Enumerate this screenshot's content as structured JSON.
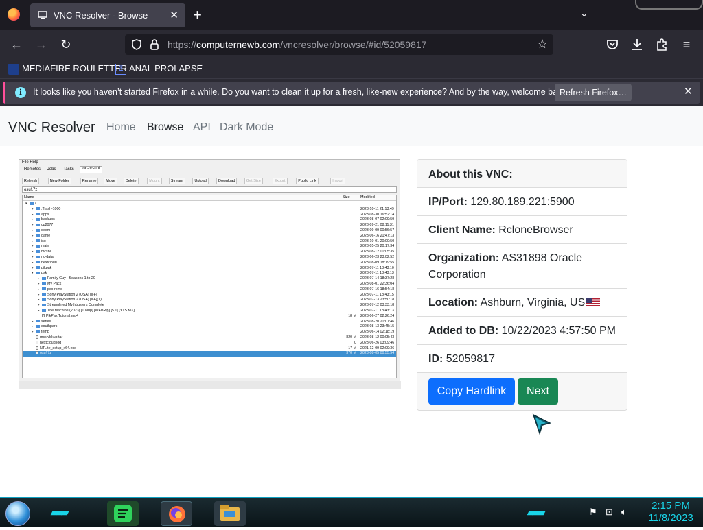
{
  "browser": {
    "tab_title": "VNC Resolver - Browse",
    "tab_close": "✕",
    "new_tab": "+",
    "url_prefix": "https://",
    "url_domain": "computernewb.com",
    "url_path": "/vncresolver/browse/#id/52059817",
    "bookmarks": [
      "MEDIAFIRE ROULETTER",
      "ANAL PROLAPSE"
    ],
    "notification": {
      "message": "It looks like you haven’t started Firefox in a while. Do you want to clean it up for a fresh, like-new experience? And by the way, welcome back!",
      "button": "Refresh Firefox…"
    }
  },
  "site": {
    "brand": "VNC Resolver",
    "nav": [
      "Home",
      "Browse",
      "API",
      "Dark Mode"
    ],
    "active_nav": "Browse"
  },
  "screenshot": {
    "menu": "File  Help",
    "tabs": [
      "Remotes",
      "Jobs",
      "Tasks",
      "od-nc-uni"
    ],
    "toolbar": [
      "Refresh",
      "New Folder",
      "Rename",
      "Move",
      "Delete",
      "Mount",
      "Stream",
      "Upload",
      "Download",
      "Get Size",
      "Export",
      "Public Link",
      "Import"
    ],
    "toolbar_disabled": [
      "Mount",
      "Get Size",
      "Export",
      "Import"
    ],
    "path": "osu!.7z",
    "columns": {
      "name": "Name",
      "size": "Size",
      "modified": "Modified"
    },
    "rows": [
      {
        "name": "/",
        "type": "folder",
        "level": 0,
        "size": "",
        "modified": ""
      },
      {
        "name": ".Trash-1000",
        "type": "folder",
        "level": 1,
        "size": "",
        "modified": "2023-10-11 21:13:49"
      },
      {
        "name": "apps",
        "type": "folder",
        "level": 1,
        "size": "",
        "modified": "2023-08-30 16:52:14"
      },
      {
        "name": "backups",
        "type": "folder",
        "level": 1,
        "size": "",
        "modified": "2023-08-07 02:09:59"
      },
      {
        "name": "cp2077",
        "type": "folder",
        "level": 1,
        "size": "",
        "modified": "2023-09-21 08:11:31"
      },
      {
        "name": "doom",
        "type": "folder",
        "level": 1,
        "size": "",
        "modified": "2023-09-09 00:56:57"
      },
      {
        "name": "game",
        "type": "folder",
        "level": 1,
        "size": "",
        "modified": "2023-06-16 21:47:13"
      },
      {
        "name": "iso",
        "type": "folder",
        "level": 1,
        "size": "",
        "modified": "2023-10-01 20:00:50"
      },
      {
        "name": "main",
        "type": "folder",
        "level": 1,
        "size": "",
        "modified": "2023-05-25 20:17:34"
      },
      {
        "name": "mcsrv",
        "type": "folder",
        "level": 1,
        "size": "",
        "modified": "2023-08-12 00:05:35"
      },
      {
        "name": "nc-data",
        "type": "folder",
        "level": 1,
        "size": "",
        "modified": "2023-06-23 23:02:52"
      },
      {
        "name": "nextcloud",
        "type": "folder",
        "level": 1,
        "size": "",
        "modified": "2023-08-09 18:19:55"
      },
      {
        "name": "pikpak",
        "type": "folder",
        "level": 1,
        "size": "",
        "modified": "2023-07-11 18:43:10"
      },
      {
        "name": "psk",
        "type": "folder",
        "level": 1,
        "size": "",
        "modified": "2023-07-11 18:43:13"
      },
      {
        "name": "Family Guy - Seasons 1 to 20",
        "type": "folder",
        "level": 2,
        "size": "",
        "modified": "2023-07-14 18:37:28"
      },
      {
        "name": "My Pack",
        "type": "folder",
        "level": 2,
        "size": "",
        "modified": "2023-08-01 22:36:04"
      },
      {
        "name": "psx-roms",
        "type": "folder",
        "level": 2,
        "size": "",
        "modified": "2023-07-16 18:54:18"
      },
      {
        "name": "Sony PlayStation 2 (USA) [il-F]",
        "type": "folder",
        "level": 2,
        "size": "",
        "modified": "2023-07-11 18:43:15"
      },
      {
        "name": "Sony PlayStation 2 (USA) [il-F](1)",
        "type": "folder",
        "level": 2,
        "size": "",
        "modified": "2023-07-13 23:50:18"
      },
      {
        "name": "Streamlined Mythbusters Complete",
        "type": "folder",
        "level": 2,
        "size": "",
        "modified": "2023-07-12 03:33:18"
      },
      {
        "name": "The Machine (2023) [1080p] [WEBRip] [5.1] [YTS.MX]",
        "type": "folder",
        "level": 2,
        "size": "",
        "modified": "2023-07-11 18:43:13"
      },
      {
        "name": "PikPak Tutorial.mp4",
        "type": "file",
        "level": 2,
        "size": "18 M",
        "modified": "2023-06-27 02:26:24"
      },
      {
        "name": "series",
        "type": "folder",
        "level": 1,
        "size": "",
        "modified": "2023-08-20 21:07:46"
      },
      {
        "name": "southpark",
        "type": "folder",
        "level": 1,
        "size": "",
        "modified": "2023-08-13 23:45:15"
      },
      {
        "name": "temp",
        "type": "folder",
        "level": 1,
        "size": "",
        "modified": "2023-06-14 02:18:19"
      },
      {
        "name": "mcsrvbkup.tar",
        "type": "file",
        "level": 1,
        "size": "820 M",
        "modified": "2023-08-12 00:05:43"
      },
      {
        "name": "nextcloud.log",
        "type": "file",
        "level": 1,
        "size": "0",
        "modified": "2023-06-26 03:09:46"
      },
      {
        "name": "NTLite_setup_x64.exe",
        "type": "file",
        "level": 1,
        "size": "17 M",
        "modified": "2021-12-09 02:09:36"
      },
      {
        "name": "osu!.7z",
        "type": "file",
        "level": 1,
        "size": "370 M",
        "modified": "2023-08-05 00:55:54",
        "selected": true
      }
    ]
  },
  "card": {
    "header": "About this VNC:",
    "fields": [
      {
        "label": "IP/Port:",
        "value": "129.80.189.221:5900"
      },
      {
        "label": "Client Name:",
        "value": "RcloneBrowser"
      },
      {
        "label": "Organization:",
        "value": "AS31898 Oracle Corporation"
      },
      {
        "label": "Location:",
        "value": "Ashburn, Virginia, US"
      },
      {
        "label": "Added to DB:",
        "value": "10/22/2023 4:57:50 PM"
      },
      {
        "label": "ID:",
        "value": "52059817"
      }
    ],
    "buttons": {
      "copy": "Copy Hardlink",
      "next": "Next"
    }
  },
  "taskbar": {
    "time": "2:15 PM",
    "date": "11/8/2023"
  },
  "colors": {
    "primary": "#0d6efd",
    "success": "#198754",
    "taskbar_accent": "#19d4e8"
  }
}
